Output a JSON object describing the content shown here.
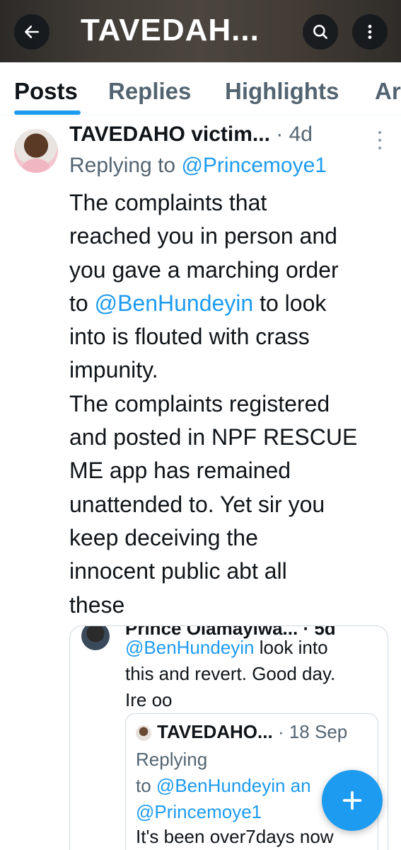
{
  "header": {
    "title": "TAVEDAH...",
    "back_icon": "arrow-left-icon",
    "search_icon": "search-icon",
    "more_icon": "more-vertical-icon"
  },
  "tabs": [
    {
      "label": "Posts",
      "active": true
    },
    {
      "label": "Replies",
      "active": false
    },
    {
      "label": "Highlights",
      "active": false
    },
    {
      "label": "Ar",
      "active": false
    }
  ],
  "post": {
    "author": "TAVEDAHO victim...",
    "separator": " · ",
    "time": "4d",
    "replying_prefix": "Replying to ",
    "replying_handle": "@Princemoye1",
    "body_lines": [
      "The complaints that",
      "reached you in person and",
      "you gave a marching order"
    ],
    "mention_prefix": "to ",
    "mention": "@BenHundeyin",
    "mention_suffix": " to look",
    "body_lines_after": [
      "into is flouted with crass",
      "impunity.",
      "The complaints registered",
      "and posted in NPF RESCUE",
      "ME app has remained",
      "unattended to. Yet sir you",
      "keep deceiving the",
      "innocent public abt all",
      "these"
    ]
  },
  "quote": {
    "cut_header": "Prince Olamayiwa... · 5d",
    "mention": "@BenHundeyin",
    "line1_suffix": " look into",
    "line2": "this and revert. Good day.",
    "line3": "Ire oo",
    "nested": {
      "author": "TAVEDAHO...",
      "separator": " · ",
      "time": "18 Sep",
      "reply_line1": "Replying",
      "reply_line2_prefix": "to ",
      "reply_line2_handle": "@BenHundeyin an",
      "reply_line3_handle": "@Princemoye1",
      "text": "It's been over7days now"
    }
  },
  "fab": {
    "icon": "plus-icon"
  },
  "colors": {
    "accent": "#1d9bf0",
    "text": "#0f1419",
    "muted": "#536471"
  }
}
